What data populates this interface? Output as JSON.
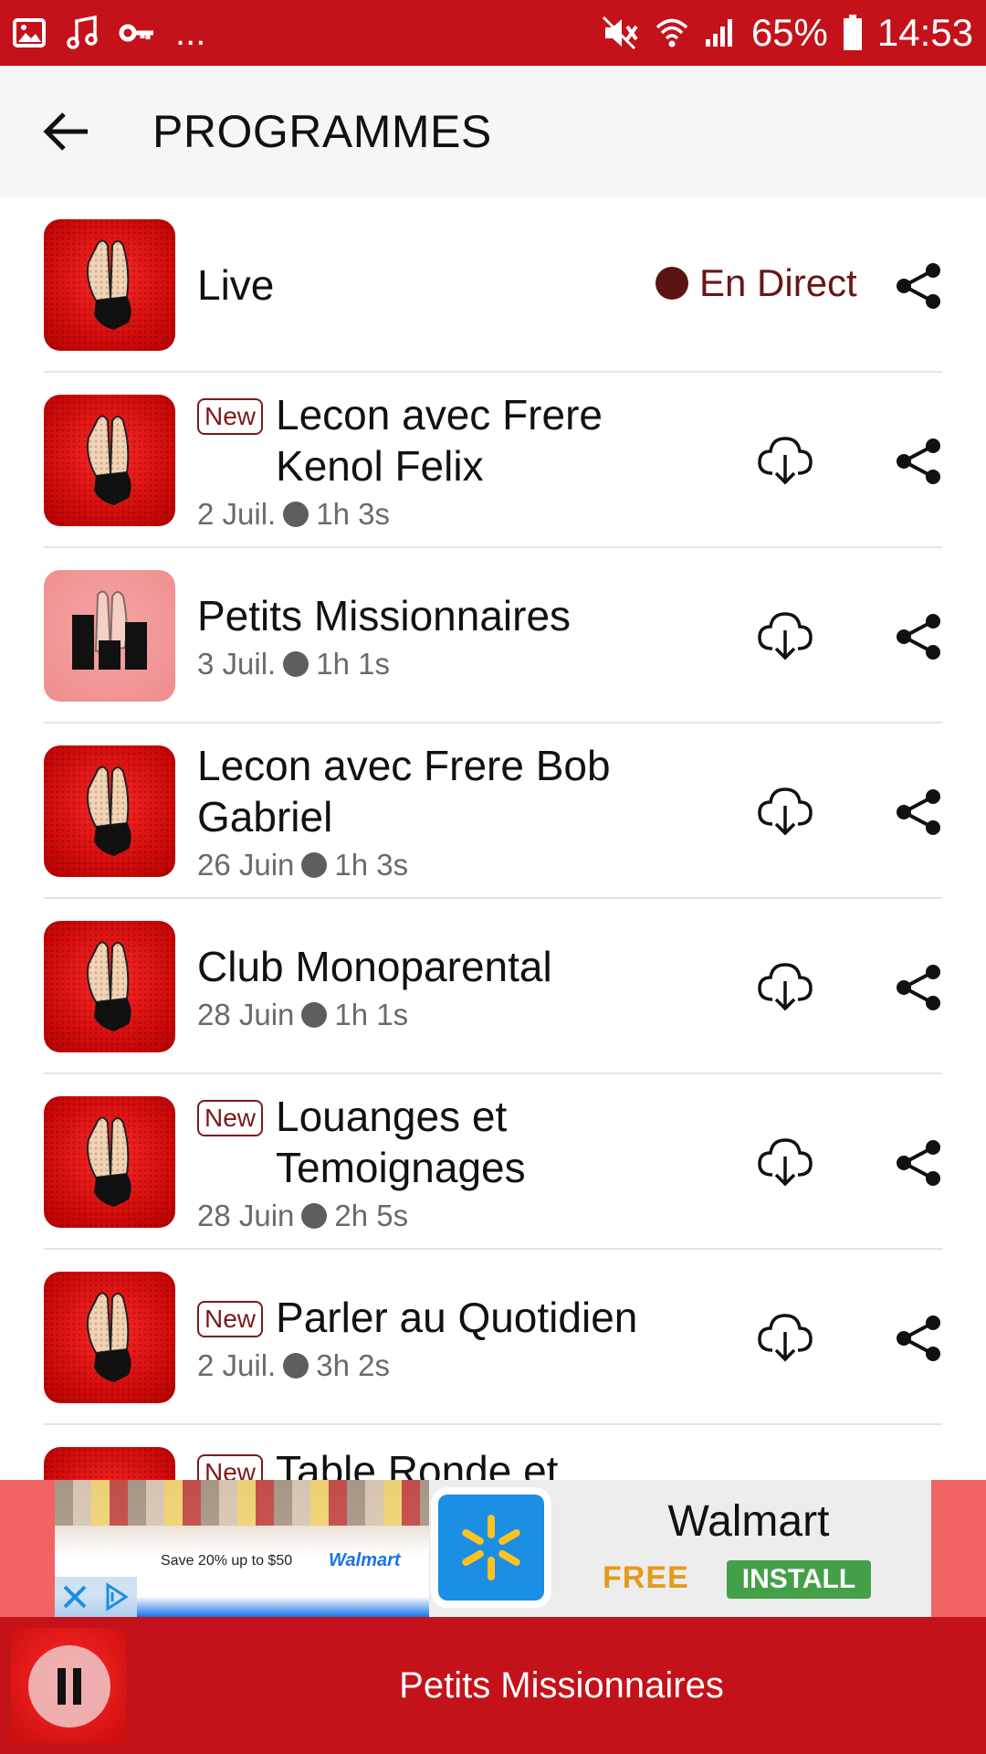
{
  "status_bar": {
    "battery_percent": "65%",
    "time": "14:53",
    "notifications_more": "...",
    "icons": [
      "image-icon",
      "music-icon",
      "key-icon",
      "mute-icon",
      "wifi-icon",
      "signal-icon",
      "battery-icon"
    ]
  },
  "app_bar": {
    "title": "PROGRAMMES"
  },
  "programs": [
    {
      "title": "Live",
      "live_label": "En Direct"
    },
    {
      "badge": "New",
      "title": "Lecon avec Frere Kenol Felix",
      "date": "2 Juil.",
      "duration": "1h 3s"
    },
    {
      "title": "Petits Missionnaires",
      "date": "3 Juil.",
      "duration": "1h 1s"
    },
    {
      "title": "Lecon avec Frere Bob Gabriel",
      "date": "26 Juin",
      "duration": "1h 3s"
    },
    {
      "title": "Club Monoparental",
      "date": "28 Juin",
      "duration": "1h 1s"
    },
    {
      "badge": "New",
      "title": "Louanges et Temoignages",
      "date": "28 Juin",
      "duration": "2h 5s"
    },
    {
      "badge": "New",
      "title": "Parler au Quotidien",
      "date": "2 Juil.",
      "duration": "3h 2s"
    },
    {
      "badge": "New",
      "title": "Table Ronde et"
    }
  ],
  "ad": {
    "brand": "Walmart",
    "free_label": "FREE",
    "install_label": "INSTALL",
    "promo_text": "Save 20% up to $50",
    "promo_brand": "Walmart"
  },
  "player": {
    "now_playing": "Petits Missionnaires"
  },
  "colors": {
    "primary": "#c4121a",
    "app_bar_bg": "#f6f6f6",
    "live_text": "#6b1515",
    "badge": "#7b1a1a",
    "ad_free": "#e59a1b",
    "ad_install": "#43a047",
    "walmart_blue": "#1a8fe3"
  }
}
